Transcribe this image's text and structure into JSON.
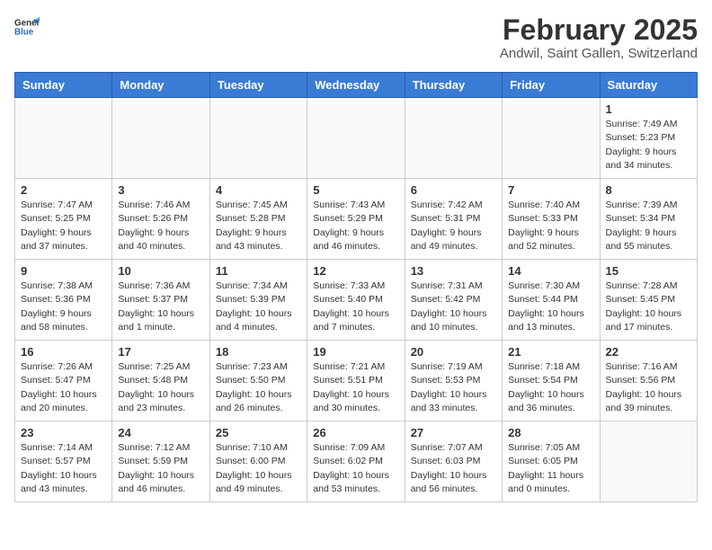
{
  "header": {
    "logo_general": "General",
    "logo_blue": "Blue",
    "month_title": "February 2025",
    "location": "Andwil, Saint Gallen, Switzerland"
  },
  "calendar": {
    "days_of_week": [
      "Sunday",
      "Monday",
      "Tuesday",
      "Wednesday",
      "Thursday",
      "Friday",
      "Saturday"
    ],
    "weeks": [
      [
        {
          "day": "",
          "info": ""
        },
        {
          "day": "",
          "info": ""
        },
        {
          "day": "",
          "info": ""
        },
        {
          "day": "",
          "info": ""
        },
        {
          "day": "",
          "info": ""
        },
        {
          "day": "",
          "info": ""
        },
        {
          "day": "1",
          "info": "Sunrise: 7:49 AM\nSunset: 5:23 PM\nDaylight: 9 hours and 34 minutes."
        }
      ],
      [
        {
          "day": "2",
          "info": "Sunrise: 7:47 AM\nSunset: 5:25 PM\nDaylight: 9 hours and 37 minutes."
        },
        {
          "day": "3",
          "info": "Sunrise: 7:46 AM\nSunset: 5:26 PM\nDaylight: 9 hours and 40 minutes."
        },
        {
          "day": "4",
          "info": "Sunrise: 7:45 AM\nSunset: 5:28 PM\nDaylight: 9 hours and 43 minutes."
        },
        {
          "day": "5",
          "info": "Sunrise: 7:43 AM\nSunset: 5:29 PM\nDaylight: 9 hours and 46 minutes."
        },
        {
          "day": "6",
          "info": "Sunrise: 7:42 AM\nSunset: 5:31 PM\nDaylight: 9 hours and 49 minutes."
        },
        {
          "day": "7",
          "info": "Sunrise: 7:40 AM\nSunset: 5:33 PM\nDaylight: 9 hours and 52 minutes."
        },
        {
          "day": "8",
          "info": "Sunrise: 7:39 AM\nSunset: 5:34 PM\nDaylight: 9 hours and 55 minutes."
        }
      ],
      [
        {
          "day": "9",
          "info": "Sunrise: 7:38 AM\nSunset: 5:36 PM\nDaylight: 9 hours and 58 minutes."
        },
        {
          "day": "10",
          "info": "Sunrise: 7:36 AM\nSunset: 5:37 PM\nDaylight: 10 hours and 1 minute."
        },
        {
          "day": "11",
          "info": "Sunrise: 7:34 AM\nSunset: 5:39 PM\nDaylight: 10 hours and 4 minutes."
        },
        {
          "day": "12",
          "info": "Sunrise: 7:33 AM\nSunset: 5:40 PM\nDaylight: 10 hours and 7 minutes."
        },
        {
          "day": "13",
          "info": "Sunrise: 7:31 AM\nSunset: 5:42 PM\nDaylight: 10 hours and 10 minutes."
        },
        {
          "day": "14",
          "info": "Sunrise: 7:30 AM\nSunset: 5:44 PM\nDaylight: 10 hours and 13 minutes."
        },
        {
          "day": "15",
          "info": "Sunrise: 7:28 AM\nSunset: 5:45 PM\nDaylight: 10 hours and 17 minutes."
        }
      ],
      [
        {
          "day": "16",
          "info": "Sunrise: 7:26 AM\nSunset: 5:47 PM\nDaylight: 10 hours and 20 minutes."
        },
        {
          "day": "17",
          "info": "Sunrise: 7:25 AM\nSunset: 5:48 PM\nDaylight: 10 hours and 23 minutes."
        },
        {
          "day": "18",
          "info": "Sunrise: 7:23 AM\nSunset: 5:50 PM\nDaylight: 10 hours and 26 minutes."
        },
        {
          "day": "19",
          "info": "Sunrise: 7:21 AM\nSunset: 5:51 PM\nDaylight: 10 hours and 30 minutes."
        },
        {
          "day": "20",
          "info": "Sunrise: 7:19 AM\nSunset: 5:53 PM\nDaylight: 10 hours and 33 minutes."
        },
        {
          "day": "21",
          "info": "Sunrise: 7:18 AM\nSunset: 5:54 PM\nDaylight: 10 hours and 36 minutes."
        },
        {
          "day": "22",
          "info": "Sunrise: 7:16 AM\nSunset: 5:56 PM\nDaylight: 10 hours and 39 minutes."
        }
      ],
      [
        {
          "day": "23",
          "info": "Sunrise: 7:14 AM\nSunset: 5:57 PM\nDaylight: 10 hours and 43 minutes."
        },
        {
          "day": "24",
          "info": "Sunrise: 7:12 AM\nSunset: 5:59 PM\nDaylight: 10 hours and 46 minutes."
        },
        {
          "day": "25",
          "info": "Sunrise: 7:10 AM\nSunset: 6:00 PM\nDaylight: 10 hours and 49 minutes."
        },
        {
          "day": "26",
          "info": "Sunrise: 7:09 AM\nSunset: 6:02 PM\nDaylight: 10 hours and 53 minutes."
        },
        {
          "day": "27",
          "info": "Sunrise: 7:07 AM\nSunset: 6:03 PM\nDaylight: 10 hours and 56 minutes."
        },
        {
          "day": "28",
          "info": "Sunrise: 7:05 AM\nSunset: 6:05 PM\nDaylight: 11 hours and 0 minutes."
        },
        {
          "day": "",
          "info": ""
        }
      ]
    ]
  }
}
